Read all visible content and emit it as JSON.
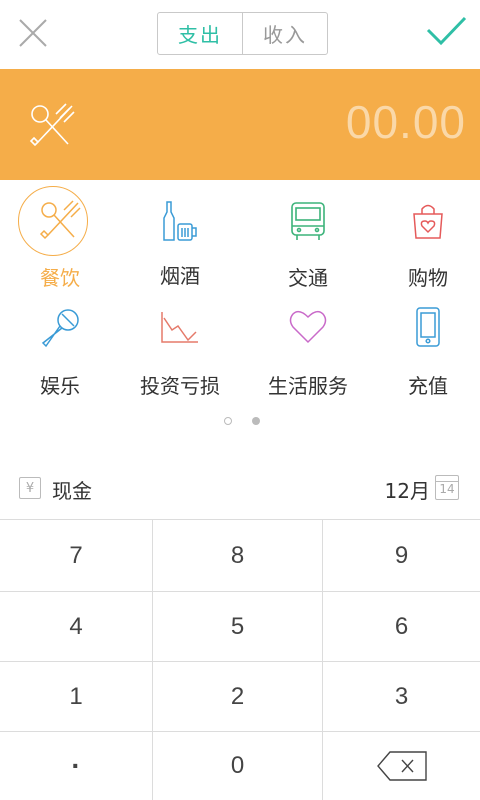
{
  "header": {
    "segments": [
      {
        "label": "支出",
        "active": true
      },
      {
        "label": "收入",
        "active": false
      }
    ]
  },
  "amount_banner": {
    "amount": "00.00",
    "icon": "fork-spoon-icon",
    "color": "#f5ad49"
  },
  "categories": [
    {
      "label": "餐饮",
      "icon": "fork-spoon-icon",
      "selected": true
    },
    {
      "label": "烟酒",
      "icon": "bottle-beer-icon",
      "selected": false
    },
    {
      "label": "交通",
      "icon": "bus-icon",
      "selected": false
    },
    {
      "label": "购物",
      "icon": "shopping-bag-icon",
      "selected": false
    },
    {
      "label": "娱乐",
      "icon": "microphone-icon",
      "selected": false
    },
    {
      "label": "投资亏损",
      "icon": "loss-chart-icon",
      "selected": false
    },
    {
      "label": "生活服务",
      "icon": "heart-icon",
      "selected": false
    },
    {
      "label": "充值",
      "icon": "phone-icon",
      "selected": false
    }
  ],
  "pager": {
    "total": 2,
    "current": 2
  },
  "account_row": {
    "account_label": "现金",
    "account_icon_glyph": "¥",
    "date_label": "12月",
    "calendar_day": "14"
  },
  "keypad": {
    "keys": [
      "7",
      "8",
      "9",
      "4",
      "5",
      "6",
      "1",
      "2",
      "3",
      "·",
      "0",
      "backspace"
    ]
  },
  "colors": {
    "accent_teal": "#2fbfa6",
    "accent_orange": "#f5ad49"
  }
}
